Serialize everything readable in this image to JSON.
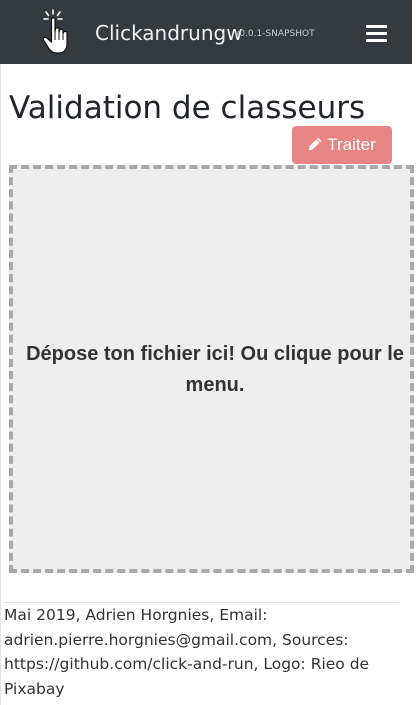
{
  "navbar": {
    "brand": "Clickandrungw",
    "version": "v0.0.1-SNAPSHOT",
    "logo_icon": "hand-pointer-click-icon",
    "menu_icon": "hamburger-menu-icon"
  },
  "page": {
    "title": "Validation de classeurs"
  },
  "actions": {
    "traiter_label": "Traiter",
    "traiter_icon": "pencil-icon",
    "traiter_color": "#e78585"
  },
  "dropzone": {
    "message": "Dépose ton fichier ici! Ou clique pour le menu."
  },
  "footer": {
    "text": "Mai 2019, Adrien Horgnies, Email: adrien.pierre.horgnies@gmail.com, Sources: https://github.com/click-and-run, Logo: Rieo de Pixabay"
  }
}
